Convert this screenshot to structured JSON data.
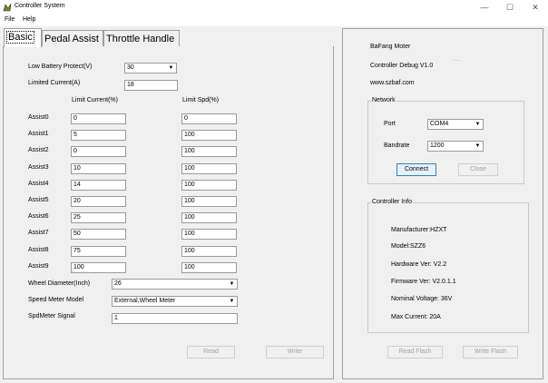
{
  "window": {
    "title": "Controller System",
    "min_glyph": "—",
    "max_glyph": "☐",
    "close_glyph": "✕"
  },
  "menu": {
    "file": "File",
    "help": "Help"
  },
  "tabs": {
    "basic": "Basic",
    "pedal_assist": "Pedal Assist",
    "throttle_handle": "Throttle Handle"
  },
  "basic": {
    "low_battery_label": "Low Battery Protect(V)",
    "low_battery_value": "30",
    "limited_current_label": "Limited Current(A)",
    "limited_current_value": "18",
    "col_limit_current": "Limit Current(%)",
    "col_limit_spd": "Limit Spd(%)",
    "assists": [
      {
        "label": "Assist0",
        "current": "0",
        "speed": "0"
      },
      {
        "label": "Assist1",
        "current": "5",
        "speed": "100"
      },
      {
        "label": "Assist2",
        "current": "0",
        "speed": "100"
      },
      {
        "label": "Assist3",
        "current": "10",
        "speed": "100"
      },
      {
        "label": "Assist4",
        "current": "14",
        "speed": "100"
      },
      {
        "label": "Assist5",
        "current": "20",
        "speed": "100"
      },
      {
        "label": "Assist6",
        "current": "25",
        "speed": "100"
      },
      {
        "label": "Assist7",
        "current": "50",
        "speed": "100"
      },
      {
        "label": "Assist8",
        "current": "75",
        "speed": "100"
      },
      {
        "label": "Assist9",
        "current": "100",
        "speed": "100"
      }
    ],
    "wheel_diameter_label": "Wheel Diameter(Inch)",
    "wheel_diameter_value": "26",
    "speed_meter_model_label": "Speed Meter Model",
    "speed_meter_model_value": "External,Wheel Meter",
    "spdmeter_signal_label": "SpdMeter Signal",
    "spdmeter_signal_value": "1",
    "read_button": "Read",
    "write_button": "Write"
  },
  "info": {
    "company": "BaFang Moter",
    "debug_version": "Controller Debug V1.0",
    "website": "www.szbaf.com",
    "dots": "·····"
  },
  "network": {
    "legend": "Network",
    "port_label": "Port",
    "port_value": "COM4",
    "baudrate_label": "Bandrate",
    "baudrate_value": "1200",
    "connect_button": "Connect",
    "close_button": "Close"
  },
  "controller_info": {
    "legend": "Controller Info",
    "manufacturer": "Manufacturer:HZXT",
    "model": "Model:SZZ6",
    "hardware": "Hardware Ver: V2.2",
    "firmware": "Firmware Ver: V2.0.1.1",
    "voltage": "Nominal Voltage: 36V",
    "max_current": "Max Current: 20A"
  },
  "flash": {
    "read_button": "Read Flash",
    "write_button": "Write Flash"
  },
  "colors": {
    "accent": "#3c7fb1",
    "window_bg": "#f0f0f0",
    "border": "#a0a0a0"
  }
}
